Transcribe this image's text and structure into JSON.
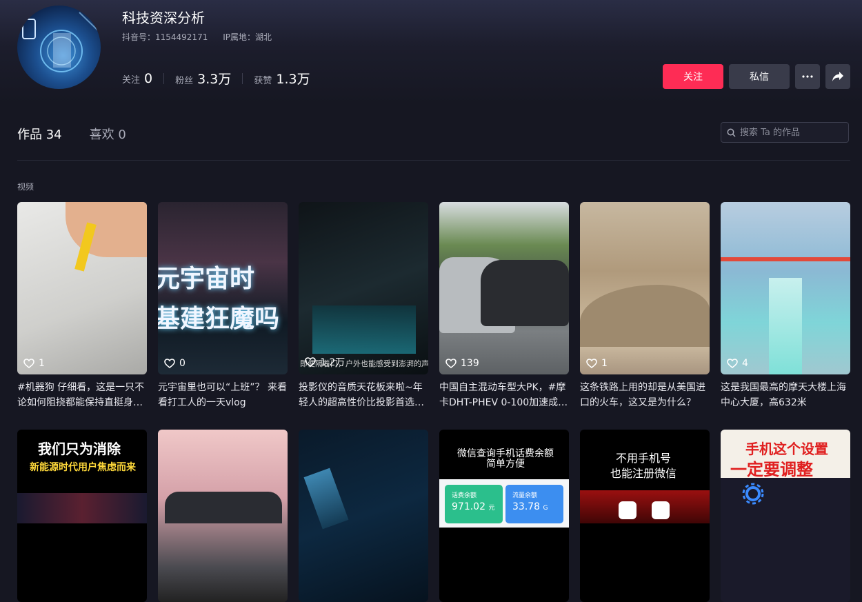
{
  "profile": {
    "nickname": "科技资深分析",
    "douyin_id": "抖音号：1154492171",
    "ip_location": "IP属地：湖北",
    "stats": [
      {
        "label": "关注",
        "value": "0"
      },
      {
        "label": "粉丝",
        "value": "3.3万"
      },
      {
        "label": "获赞",
        "value": "1.3万"
      }
    ]
  },
  "actions": {
    "follow": "关注",
    "message": "私信",
    "more": "more-horizontal-icon",
    "share": "share-arrow-icon"
  },
  "tabs": [
    {
      "label": "作品 34"
    },
    {
      "label": "喜欢 0"
    }
  ],
  "search": {
    "placeholder": "搜索 Ta 的作品"
  },
  "section_label": "视频",
  "videos": [
    {
      "likes": "1",
      "title": "#机器狗 仔细看，这是一只不论如何阻挠都能保持直挺身…"
    },
    {
      "likes": "0",
      "title": "元宇宙里也可以“上班”？ 来看看打工人的一天vlog",
      "overlay": [
        "元宇宙时",
        "基建狂魔吗"
      ]
    },
    {
      "likes": "1.2万",
      "title": "投影仪的音质天花板来啦~年轻人的超高性价比投影首选…",
      "caption": "即便隔着门，户外也能感受到澎湃的声浪"
    },
    {
      "likes": "139",
      "title": "中国自主混动车型大PK，#摩卡DHT-PHEV 0-100加速成…"
    },
    {
      "likes": "1",
      "title": "这条铁路上用的却是从美国进口的火车，这又是为什么？"
    },
    {
      "likes": "4",
      "title": "这是我国最高的摩天大楼上海中心大厦，高632米"
    }
  ],
  "row2": [
    {
      "overlay": [
        "我们只为消除",
        "新能源时代用户焦虑而来"
      ]
    },
    {},
    {},
    {
      "overlay": [
        "微信查询手机话费余额",
        "简单方便"
      ],
      "balance_label": "话费余额",
      "balance": "971.02",
      "balance_unit": "元",
      "flow_label": "流量余额",
      "flow": "33.78",
      "flow_unit": "G"
    },
    {
      "overlay": [
        "不用手机号",
        "也能注册微信"
      ]
    },
    {
      "overlay": [
        "手机这个设置",
        "一定要调整"
      ]
    }
  ],
  "colors": {
    "accent": "#fe2c55",
    "background": "#161722",
    "button": "#393b4a"
  }
}
